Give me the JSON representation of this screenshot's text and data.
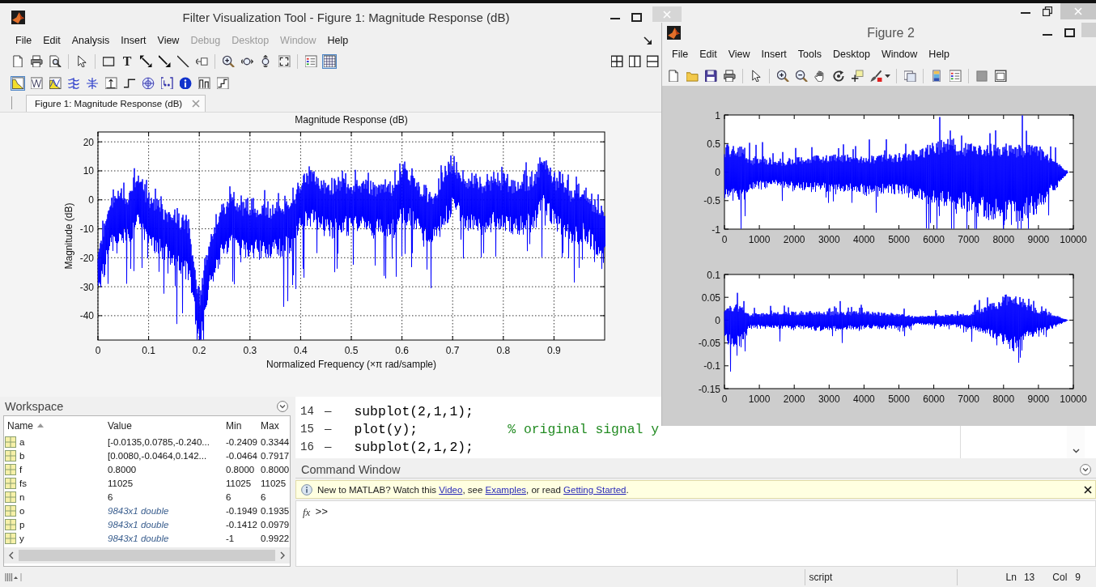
{
  "filter_visualization_window": {
    "title": "Filter Visualization Tool - Figure 1: Magnitude Response (dB)",
    "menu": [
      {
        "label": "File",
        "disabled": false
      },
      {
        "label": "Edit",
        "disabled": false
      },
      {
        "label": "Analysis",
        "disabled": false
      },
      {
        "label": "Insert",
        "disabled": false
      },
      {
        "label": "View",
        "disabled": false
      },
      {
        "label": "Debug",
        "disabled": true
      },
      {
        "label": "Desktop",
        "disabled": true
      },
      {
        "label": "Window",
        "disabled": true
      },
      {
        "label": "Help",
        "disabled": false
      }
    ],
    "toolbar": {
      "groups": [
        [
          {
            "kind": "new",
            "pressed": false
          },
          {
            "kind": "print",
            "pressed": false
          },
          {
            "kind": "print_preview",
            "pressed": false
          }
        ],
        [
          {
            "kind": "pointer",
            "pressed": false
          }
        ],
        [
          {
            "kind": "rectangle",
            "pressed": false
          },
          {
            "kind": "text",
            "label": "T",
            "pressed": false
          },
          {
            "kind": "double_arrow",
            "pressed": false
          },
          {
            "kind": "arrow",
            "pressed": false
          },
          {
            "kind": "line",
            "pressed": false
          },
          {
            "kind": "pin",
            "pressed": false
          }
        ],
        [
          {
            "kind": "zoom_in",
            "pressed": false
          },
          {
            "kind": "zoom_x",
            "pressed": false
          },
          {
            "kind": "zoom_y",
            "pressed": false
          },
          {
            "kind": "full_view",
            "pressed": false
          }
        ],
        [
          {
            "kind": "legend",
            "pressed": false
          },
          {
            "kind": "grid",
            "pressed": true
          }
        ]
      ],
      "layout_buttons": [
        {
          "kind": "four_panes"
        },
        {
          "kind": "two_columns"
        },
        {
          "kind": "two_rows"
        }
      ]
    },
    "analysis_toolbar": [
      {
        "kind": "magnitude",
        "selected": true
      },
      {
        "kind": "phase",
        "selected": false
      },
      {
        "kind": "magnitude_phase",
        "selected": false
      },
      {
        "kind": "group_delay",
        "selected": false
      },
      {
        "kind": "phase_delay",
        "selected": false
      },
      {
        "kind": "impulse",
        "selected": false
      },
      {
        "kind": "step",
        "selected": false
      },
      {
        "kind": "pole_zero",
        "selected": false
      },
      {
        "kind": "coefficients",
        "selected": false
      },
      {
        "kind": "info",
        "selected": false
      },
      {
        "kind": "magnitude_estimate",
        "selected": false
      },
      {
        "kind": "noise",
        "selected": false
      }
    ],
    "tabs": [
      {
        "label": "Figure 1: Magnitude Response (dB)",
        "selected": true
      }
    ],
    "chart_data": {
      "type": "line",
      "title": "Magnitude Response (dB)",
      "xlabel": "Normalized Frequency (×π rad/sample)",
      "ylabel": "Magnitude (dB)",
      "xlim": [
        0,
        1
      ],
      "ylim": [
        -48.4,
        23.4
      ],
      "xticks": [
        0,
        0.1,
        0.2,
        0.3,
        0.4,
        0.5,
        0.6,
        0.7,
        0.8,
        0.9
      ],
      "yticks": [
        -40,
        -30,
        -20,
        -10,
        0,
        10,
        20
      ],
      "grid": true
    }
  },
  "figure_2_window": {
    "title": "Figure 2",
    "menu": [
      "File",
      "Edit",
      "View",
      "Insert",
      "Tools",
      "Desktop",
      "Window",
      "Help"
    ],
    "toolbar": {
      "groups": [
        [
          {
            "kind": "new"
          },
          {
            "kind": "open"
          },
          {
            "kind": "save"
          },
          {
            "kind": "print"
          }
        ],
        [
          {
            "kind": "pointer"
          }
        ],
        [
          {
            "kind": "zoom_in"
          },
          {
            "kind": "zoom_out"
          },
          {
            "kind": "pan"
          },
          {
            "kind": "rotate"
          },
          {
            "kind": "data_cursor"
          },
          {
            "kind": "brush"
          }
        ],
        [
          {
            "kind": "link"
          }
        ],
        [
          {
            "kind": "colorbar"
          },
          {
            "kind": "legend"
          }
        ],
        [
          {
            "kind": "hide_tools"
          },
          {
            "kind": "show_tools"
          }
        ]
      ]
    },
    "axes": [
      {
        "chart_data": {
          "type": "line",
          "xlim": [
            0,
            10000
          ],
          "ylim": [
            -1,
            1
          ],
          "xticks": [
            0,
            1000,
            2000,
            3000,
            4000,
            5000,
            6000,
            7000,
            8000,
            9000,
            10000
          ],
          "yticks": [
            -1,
            -0.5,
            0,
            0.5,
            1
          ]
        }
      },
      {
        "chart_data": {
          "type": "line",
          "xlim": [
            0,
            10000
          ],
          "ylim": [
            -0.15,
            0.1
          ],
          "xticks": [
            0,
            1000,
            2000,
            3000,
            4000,
            5000,
            6000,
            7000,
            8000,
            9000,
            10000
          ],
          "yticks": [
            -0.15,
            -0.1,
            -0.05,
            0,
            0.05,
            0.1
          ]
        }
      }
    ]
  },
  "workspace": {
    "title": "Workspace",
    "columns": [
      {
        "label": "Name",
        "sorted": true
      },
      {
        "label": "Value",
        "sorted": false
      },
      {
        "label": "Min",
        "sorted": false
      },
      {
        "label": "Max",
        "sorted": false
      }
    ],
    "rows": [
      {
        "name": "a",
        "kind": "preview",
        "value": "[-0.0135,0.0785,-0.240...",
        "min": "-0.2409",
        "max": "0.3344"
      },
      {
        "name": "b",
        "kind": "preview",
        "value": "[0.0080,-0.0464,0.142...",
        "min": "-0.0464",
        "max": "0.7917"
      },
      {
        "name": "f",
        "kind": "preview",
        "value": "0.8000",
        "min": "0.8000",
        "max": "0.8000"
      },
      {
        "name": "fs",
        "kind": "preview",
        "value": "11025",
        "min": "11025",
        "max": "11025"
      },
      {
        "name": "n",
        "kind": "preview",
        "value": "6",
        "min": "6",
        "max": "6"
      },
      {
        "name": "o",
        "kind": "summary",
        "value": "9843x1 double",
        "min": "-0.1949",
        "max": "0.1935"
      },
      {
        "name": "p",
        "kind": "summary",
        "value": "9843x1 double",
        "min": "-0.1412",
        "max": "0.0979"
      },
      {
        "name": "y",
        "kind": "summary",
        "value": "9843x1 double",
        "min": "-1",
        "max": "0.9922"
      }
    ]
  },
  "editor": {
    "lines": [
      {
        "number": "14",
        "marker": "—",
        "code": "subplot(2,1,1);"
      },
      {
        "number": "15",
        "marker": "—",
        "code": "plot(y);",
        "comment": "% original signal y"
      },
      {
        "number": "16",
        "marker": "—",
        "code": "subplot(2,1,2);"
      }
    ]
  },
  "command_window": {
    "title": "Command Window",
    "notice": [
      {
        "kind": "text",
        "text": "New to MATLAB? Watch this "
      },
      {
        "kind": "link",
        "text": "Video"
      },
      {
        "kind": "text",
        "text": ", see "
      },
      {
        "kind": "link",
        "text": "Examples"
      },
      {
        "kind": "text",
        "text": ", or read "
      },
      {
        "kind": "link",
        "text": "Getting Started"
      },
      {
        "kind": "text",
        "text": "."
      }
    ],
    "function_button": "fx",
    "prompt": ">>"
  },
  "status_bar": {
    "mode": "script",
    "position": [
      {
        "label": "Ln",
        "value": "13"
      },
      {
        "label": "Col",
        "value": "9"
      }
    ]
  }
}
